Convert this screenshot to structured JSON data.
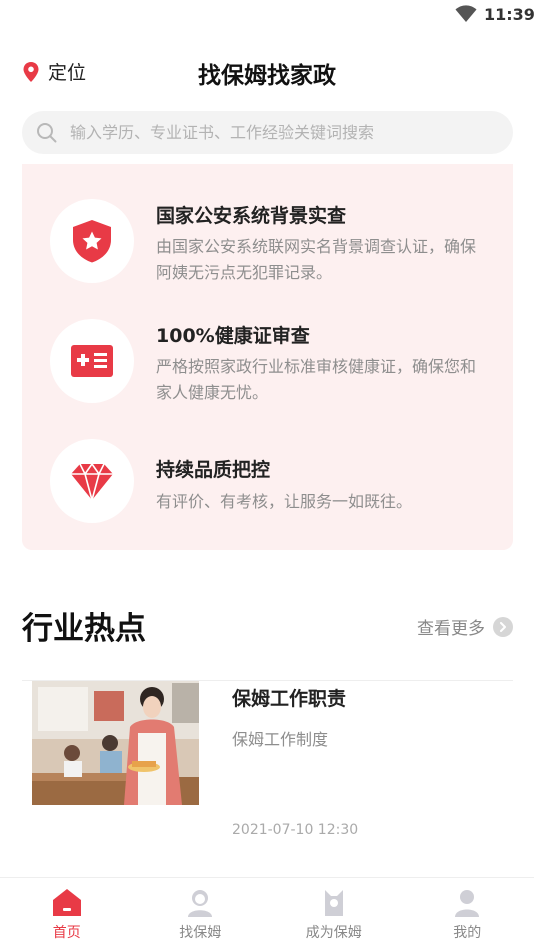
{
  "status_bar": {
    "time": "11:39"
  },
  "header": {
    "location_label": "定位",
    "title": "找保姆找家政"
  },
  "search": {
    "placeholder": "输入学历、专业证书、工作经验关键词搜索"
  },
  "guarantees": [
    {
      "icon": "shield-star-icon",
      "title": "国家公安系统背景实查",
      "desc": "由国家公安系统联网实名背景调查认证，确保阿姨无污点无犯罪记录。"
    },
    {
      "icon": "health-card-icon",
      "title": "100%健康证审查",
      "desc": "严格按照家政行业标准审核健康证，确保您和家人健康无忧。"
    },
    {
      "icon": "diamond-icon",
      "title": "持续品质把控",
      "desc": "有评价、有考核，让服务一如既往。"
    }
  ],
  "hot": {
    "title": "行业热点",
    "more_label": "查看更多"
  },
  "news": [
    {
      "title": "保姆工作职责",
      "subtitle": "保姆工作制度",
      "date": "2021-07-10 12:30"
    }
  ],
  "tabs": [
    {
      "label": "首页",
      "icon": "home-icon",
      "active": true
    },
    {
      "label": "找保姆",
      "icon": "nanny-icon",
      "active": false
    },
    {
      "label": "成为保姆",
      "icon": "become-nanny-icon",
      "active": false
    },
    {
      "label": "我的",
      "icon": "user-icon",
      "active": false
    }
  ],
  "colors": {
    "accent": "#e83a46",
    "guarantee_bg": "#fdf0f0",
    "muted_text": "#8e8e8e"
  }
}
